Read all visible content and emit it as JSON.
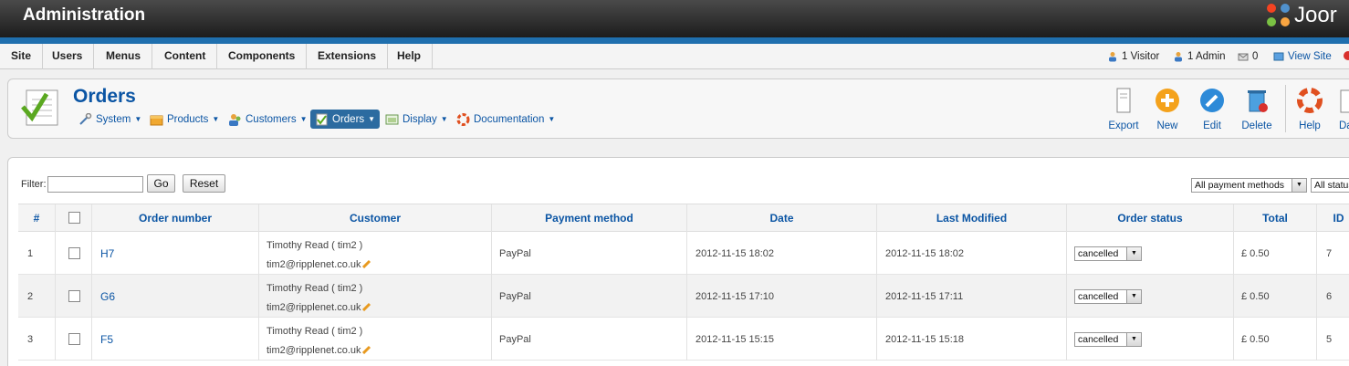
{
  "header": {
    "title": "Administration",
    "logo_text": "Joor"
  },
  "menu": [
    "Site",
    "Users",
    "Menus",
    "Content",
    "Components",
    "Extensions",
    "Help"
  ],
  "status": {
    "visitors": "1 Visitor",
    "admins": "1 Admin",
    "messages": "0",
    "view_site": "View Site"
  },
  "page": {
    "title": "Orders",
    "submenu": [
      {
        "label": "System",
        "icon": "tools-icon"
      },
      {
        "label": "Products",
        "icon": "box-icon"
      },
      {
        "label": "Customers",
        "icon": "users-icon"
      },
      {
        "label": "Orders",
        "icon": "orders-icon",
        "active": true
      },
      {
        "label": "Display",
        "icon": "display-icon"
      },
      {
        "label": "Documentation",
        "icon": "lifebuoy-icon"
      }
    ]
  },
  "toolbar": {
    "export": "Export",
    "new": "New",
    "edit": "Edit",
    "delete": "Delete",
    "help": "Help",
    "d": "Da"
  },
  "filter": {
    "label": "Filter:",
    "value": "",
    "go": "Go",
    "reset": "Reset",
    "payment_select": "All payment methods",
    "status_select": "All status"
  },
  "table": {
    "headers": [
      "#",
      "",
      "Order number",
      "Customer",
      "Payment method",
      "Date",
      "Last Modified",
      "Order status",
      "Total",
      "ID"
    ],
    "rows": [
      {
        "n": "1",
        "order": "H7",
        "cust_name": "Timothy Read ( tim2 )",
        "cust_email": "tim2@ripplenet.co.uk",
        "payment": "PayPal",
        "date": "2012-11-15 18:02",
        "modified": "2012-11-15 18:02",
        "status": "cancelled",
        "total": "£ 0.50",
        "id": "7"
      },
      {
        "n": "2",
        "order": "G6",
        "cust_name": "Timothy Read ( tim2 )",
        "cust_email": "tim2@ripplenet.co.uk",
        "payment": "PayPal",
        "date": "2012-11-15 17:10",
        "modified": "2012-11-15 17:11",
        "status": "cancelled",
        "total": "£ 0.50",
        "id": "6"
      },
      {
        "n": "3",
        "order": "F5",
        "cust_name": "Timothy Read ( tim2 )",
        "cust_email": "tim2@ripplenet.co.uk",
        "payment": "PayPal",
        "date": "2012-11-15 15:15",
        "modified": "2012-11-15 15:18",
        "status": "cancelled",
        "total": "£ 0.50",
        "id": "5"
      }
    ]
  }
}
